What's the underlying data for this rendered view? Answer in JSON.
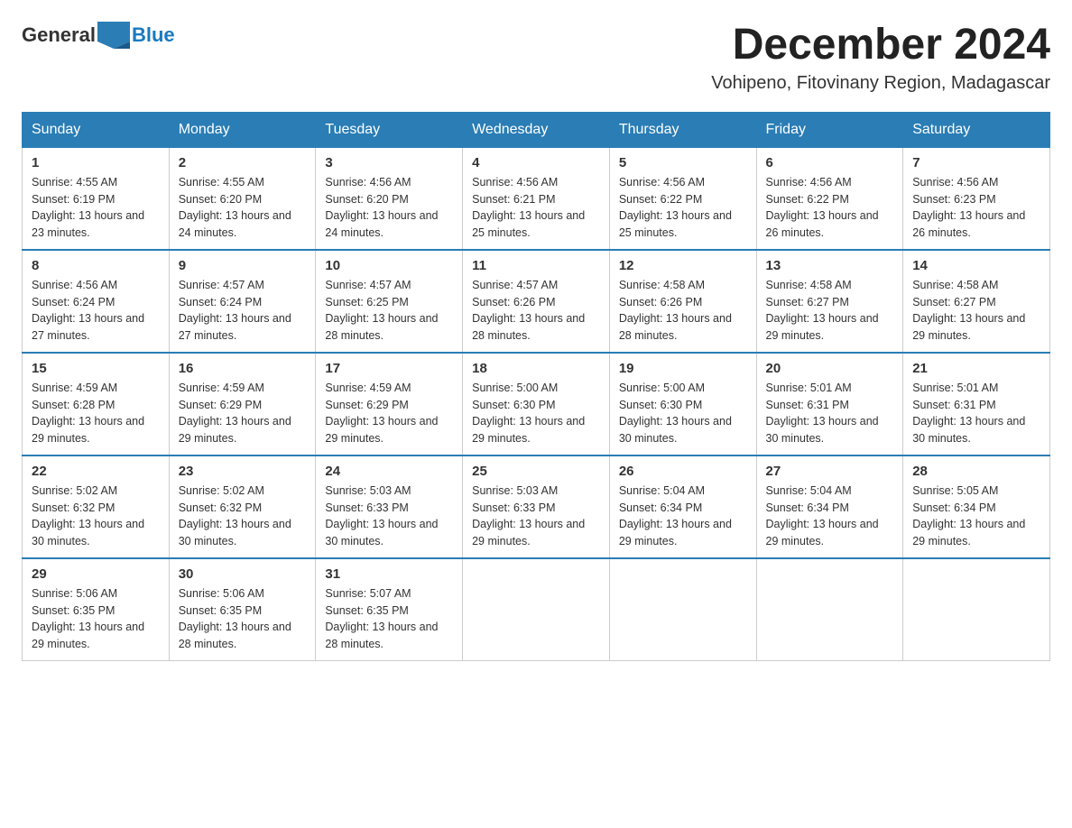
{
  "logo": {
    "general": "General",
    "blue": "Blue"
  },
  "title": "December 2024",
  "subtitle": "Vohipeno, Fitovinany Region, Madagascar",
  "days_of_week": [
    "Sunday",
    "Monday",
    "Tuesday",
    "Wednesday",
    "Thursday",
    "Friday",
    "Saturday"
  ],
  "weeks": [
    [
      {
        "day": "1",
        "sunrise": "4:55 AM",
        "sunset": "6:19 PM",
        "daylight": "13 hours and 23 minutes."
      },
      {
        "day": "2",
        "sunrise": "4:55 AM",
        "sunset": "6:20 PM",
        "daylight": "13 hours and 24 minutes."
      },
      {
        "day": "3",
        "sunrise": "4:56 AM",
        "sunset": "6:20 PM",
        "daylight": "13 hours and 24 minutes."
      },
      {
        "day": "4",
        "sunrise": "4:56 AM",
        "sunset": "6:21 PM",
        "daylight": "13 hours and 25 minutes."
      },
      {
        "day": "5",
        "sunrise": "4:56 AM",
        "sunset": "6:22 PM",
        "daylight": "13 hours and 25 minutes."
      },
      {
        "day": "6",
        "sunrise": "4:56 AM",
        "sunset": "6:22 PM",
        "daylight": "13 hours and 26 minutes."
      },
      {
        "day": "7",
        "sunrise": "4:56 AM",
        "sunset": "6:23 PM",
        "daylight": "13 hours and 26 minutes."
      }
    ],
    [
      {
        "day": "8",
        "sunrise": "4:56 AM",
        "sunset": "6:24 PM",
        "daylight": "13 hours and 27 minutes."
      },
      {
        "day": "9",
        "sunrise": "4:57 AM",
        "sunset": "6:24 PM",
        "daylight": "13 hours and 27 minutes."
      },
      {
        "day": "10",
        "sunrise": "4:57 AM",
        "sunset": "6:25 PM",
        "daylight": "13 hours and 28 minutes."
      },
      {
        "day": "11",
        "sunrise": "4:57 AM",
        "sunset": "6:26 PM",
        "daylight": "13 hours and 28 minutes."
      },
      {
        "day": "12",
        "sunrise": "4:58 AM",
        "sunset": "6:26 PM",
        "daylight": "13 hours and 28 minutes."
      },
      {
        "day": "13",
        "sunrise": "4:58 AM",
        "sunset": "6:27 PM",
        "daylight": "13 hours and 29 minutes."
      },
      {
        "day": "14",
        "sunrise": "4:58 AM",
        "sunset": "6:27 PM",
        "daylight": "13 hours and 29 minutes."
      }
    ],
    [
      {
        "day": "15",
        "sunrise": "4:59 AM",
        "sunset": "6:28 PM",
        "daylight": "13 hours and 29 minutes."
      },
      {
        "day": "16",
        "sunrise": "4:59 AM",
        "sunset": "6:29 PM",
        "daylight": "13 hours and 29 minutes."
      },
      {
        "day": "17",
        "sunrise": "4:59 AM",
        "sunset": "6:29 PM",
        "daylight": "13 hours and 29 minutes."
      },
      {
        "day": "18",
        "sunrise": "5:00 AM",
        "sunset": "6:30 PM",
        "daylight": "13 hours and 29 minutes."
      },
      {
        "day": "19",
        "sunrise": "5:00 AM",
        "sunset": "6:30 PM",
        "daylight": "13 hours and 30 minutes."
      },
      {
        "day": "20",
        "sunrise": "5:01 AM",
        "sunset": "6:31 PM",
        "daylight": "13 hours and 30 minutes."
      },
      {
        "day": "21",
        "sunrise": "5:01 AM",
        "sunset": "6:31 PM",
        "daylight": "13 hours and 30 minutes."
      }
    ],
    [
      {
        "day": "22",
        "sunrise": "5:02 AM",
        "sunset": "6:32 PM",
        "daylight": "13 hours and 30 minutes."
      },
      {
        "day": "23",
        "sunrise": "5:02 AM",
        "sunset": "6:32 PM",
        "daylight": "13 hours and 30 minutes."
      },
      {
        "day": "24",
        "sunrise": "5:03 AM",
        "sunset": "6:33 PM",
        "daylight": "13 hours and 30 minutes."
      },
      {
        "day": "25",
        "sunrise": "5:03 AM",
        "sunset": "6:33 PM",
        "daylight": "13 hours and 29 minutes."
      },
      {
        "day": "26",
        "sunrise": "5:04 AM",
        "sunset": "6:34 PM",
        "daylight": "13 hours and 29 minutes."
      },
      {
        "day": "27",
        "sunrise": "5:04 AM",
        "sunset": "6:34 PM",
        "daylight": "13 hours and 29 minutes."
      },
      {
        "day": "28",
        "sunrise": "5:05 AM",
        "sunset": "6:34 PM",
        "daylight": "13 hours and 29 minutes."
      }
    ],
    [
      {
        "day": "29",
        "sunrise": "5:06 AM",
        "sunset": "6:35 PM",
        "daylight": "13 hours and 29 minutes."
      },
      {
        "day": "30",
        "sunrise": "5:06 AM",
        "sunset": "6:35 PM",
        "daylight": "13 hours and 28 minutes."
      },
      {
        "day": "31",
        "sunrise": "5:07 AM",
        "sunset": "6:35 PM",
        "daylight": "13 hours and 28 minutes."
      },
      null,
      null,
      null,
      null
    ]
  ]
}
